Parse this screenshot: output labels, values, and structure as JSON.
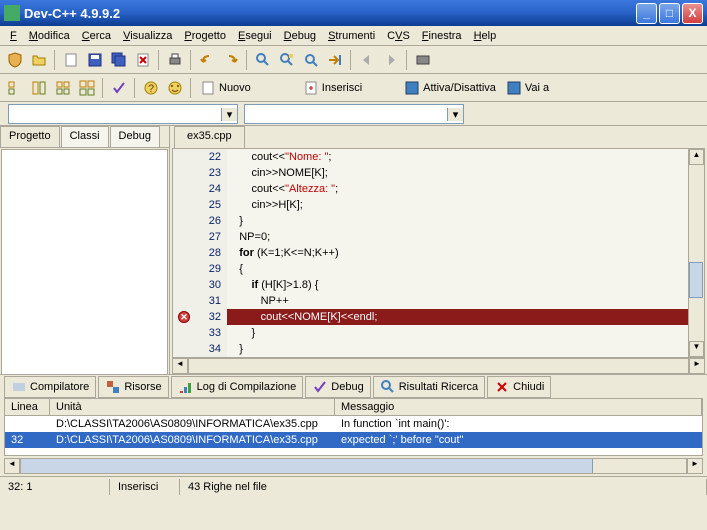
{
  "window": {
    "title": "Dev-C++ 4.9.9.2"
  },
  "menu": {
    "file": "File",
    "edit": "Modifica",
    "search": "Cerca",
    "view": "Visualizza",
    "project": "Progetto",
    "run": "Esegui",
    "debug": "Debug",
    "tools": "Strumenti",
    "cvs": "CVS",
    "window": "Finestra",
    "help": "Help"
  },
  "toolbar2": {
    "nuovo": "Nuovo",
    "inserisci": "Inserisci",
    "attiva": "Attiva/Disattiva",
    "vai": "Vai a"
  },
  "side_tabs": {
    "progetto": "Progetto",
    "classi": "Classi",
    "debug": "Debug"
  },
  "editor": {
    "tab": "ex35.cpp",
    "lines": [
      {
        "n": 22,
        "raw": "cout<<\"Nome: \";",
        "tokens": [
          [
            "        cout<<",
            "p"
          ],
          [
            "\"Nome: \"",
            "s"
          ],
          [
            ";",
            "p"
          ]
        ]
      },
      {
        "n": 23,
        "raw": "cin>>NOME[K];",
        "tokens": [
          [
            "        cin>>NOME[K];",
            "p"
          ]
        ]
      },
      {
        "n": 24,
        "raw": "cout<<\"Altezza: \";",
        "tokens": [
          [
            "        cout<<",
            "p"
          ],
          [
            "\"Altezza: \"",
            "s"
          ],
          [
            ";",
            "p"
          ]
        ]
      },
      {
        "n": 25,
        "raw": "cin>>H[K];",
        "tokens": [
          [
            "        cin>>H[K];",
            "p"
          ]
        ]
      },
      {
        "n": 26,
        "raw": "}",
        "tokens": [
          [
            "    }",
            "p"
          ]
        ]
      },
      {
        "n": 27,
        "raw": "NP=0;",
        "tokens": [
          [
            "    NP=",
            "p"
          ],
          [
            "0",
            "n"
          ],
          [
            ";",
            "p"
          ]
        ]
      },
      {
        "n": 28,
        "raw": "for (K=1;K<=N;K++)",
        "tokens": [
          [
            "    ",
            "p"
          ],
          [
            "for",
            "k"
          ],
          [
            " (K=",
            "p"
          ],
          [
            "1",
            "n"
          ],
          [
            ";K<=N;K++)",
            "p"
          ]
        ]
      },
      {
        "n": 29,
        "raw": "{",
        "tokens": [
          [
            "    {",
            "p"
          ]
        ]
      },
      {
        "n": 30,
        "raw": "if (H[K]>1.8) {",
        "tokens": [
          [
            "        ",
            "p"
          ],
          [
            "if",
            "k"
          ],
          [
            " (H[K]>",
            "p"
          ],
          [
            "1.8",
            "n"
          ],
          [
            ") {",
            "p"
          ]
        ]
      },
      {
        "n": 31,
        "raw": "NP++",
        "tokens": [
          [
            "           NP++",
            "p"
          ]
        ]
      },
      {
        "n": 32,
        "raw": "cout<<NOME[K]<<endl;",
        "tokens": [
          [
            "           cout<<NOME[K]<<endl;",
            "e"
          ]
        ],
        "error": true
      },
      {
        "n": 33,
        "raw": "}",
        "tokens": [
          [
            "        }",
            "p"
          ]
        ]
      },
      {
        "n": 34,
        "raw": "}",
        "tokens": [
          [
            "    }",
            "p"
          ]
        ]
      }
    ]
  },
  "bottom_tabs": {
    "compilatore": "Compilatore",
    "risorse": "Risorse",
    "log": "Log di Compilazione",
    "debug": "Debug",
    "risultati": "Risultati Ricerca",
    "chiudi": "Chiudi"
  },
  "compiler": {
    "headers": {
      "linea": "Linea",
      "unita": "Unità",
      "messaggio": "Messaggio"
    },
    "rows": [
      {
        "linea": "",
        "unita": "D:\\CLASSI\\TA2006\\AS0809\\INFORMATICA\\ex35.cpp",
        "msg": "In function `int main()':",
        "sel": false
      },
      {
        "linea": "32",
        "unita": "D:\\CLASSI\\TA2006\\AS0809\\INFORMATICA\\ex35.cpp",
        "msg": "expected `;' before \"cout\"",
        "sel": true
      }
    ]
  },
  "status": {
    "pos": "32: 1",
    "mode": "Inserisci",
    "lines": "43 Righe nel file"
  }
}
